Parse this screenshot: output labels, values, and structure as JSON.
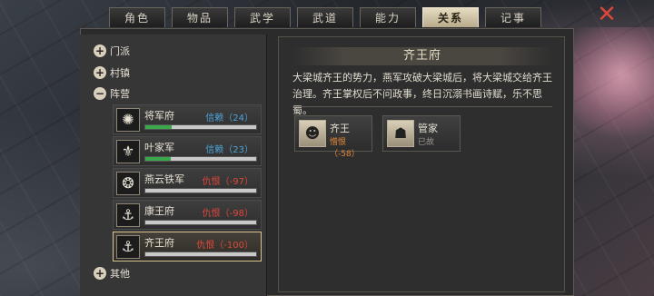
{
  "tabs": [
    {
      "label": "角色",
      "active": false
    },
    {
      "label": "物品",
      "active": false
    },
    {
      "label": "武学",
      "active": false
    },
    {
      "label": "武道",
      "active": false
    },
    {
      "label": "能力",
      "active": false
    },
    {
      "label": "关系",
      "active": true
    },
    {
      "label": "记事",
      "active": false
    }
  ],
  "close_icon": "✕",
  "tree": {
    "groups": [
      {
        "label": "门派",
        "toggle": "+"
      },
      {
        "label": "村镇",
        "toggle": "+"
      },
      {
        "label": "阵营",
        "toggle": "−"
      },
      {
        "label": "其他",
        "toggle": "+"
      }
    ],
    "factions": [
      {
        "name": "将军府",
        "relation": "信赖（24）",
        "relation_type": "trust",
        "bar_fraction": 0.24,
        "emblem": "✺"
      },
      {
        "name": "叶家军",
        "relation": "信赖（23）",
        "relation_type": "trust",
        "bar_fraction": 0.23,
        "emblem": "⚜"
      },
      {
        "name": "燕云铁军",
        "relation": "仇恨（-97）",
        "relation_type": "hate",
        "bar_fraction": 0,
        "emblem": "❂"
      },
      {
        "name": "康王府",
        "relation": "仇恨（-98）",
        "relation_type": "hate",
        "bar_fraction": 0,
        "emblem": "⚓"
      },
      {
        "name": "齐王府",
        "relation": "仇恨（-100）",
        "relation_type": "hate",
        "bar_fraction": 0,
        "emblem": "⚓",
        "selected": true
      }
    ]
  },
  "detail": {
    "title": "齐王府",
    "description": "大梁城齐王的势力，燕军攻破大梁城后，将大梁城交给齐王治理。齐王掌权后不问政事，终日沉溺书画诗赋，乐不思蜀。",
    "members": [
      {
        "name": "齐王",
        "status": "憎恨（-58）",
        "status_type": "hate",
        "portrait": "☻"
      },
      {
        "name": "管家",
        "status": "已故",
        "status_type": "dead",
        "portrait": "☗"
      }
    ]
  },
  "colors": {
    "trust": "#4ea3d8",
    "hate": "#e0473b",
    "bar_green": "#3aa84a",
    "tab_active": "#e6dcc2",
    "close": "#d9463a"
  }
}
